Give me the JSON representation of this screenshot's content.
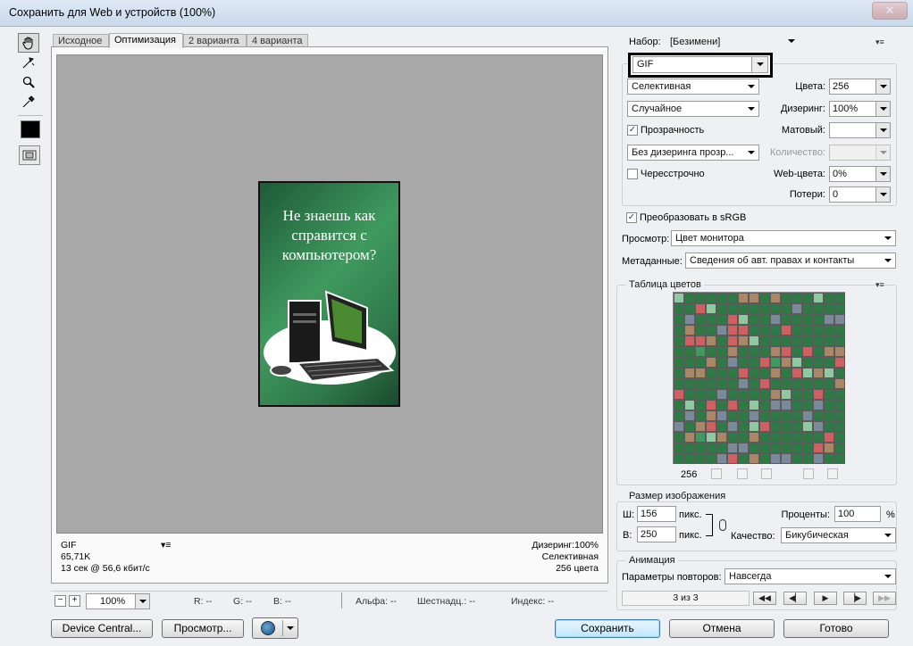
{
  "window": {
    "title": "Сохранить для Web и устройств (100%)"
  },
  "tabs": [
    {
      "label": "Исходное"
    },
    {
      "label": "Оптимизация"
    },
    {
      "label": "2 варианта"
    },
    {
      "label": "4 варианта"
    }
  ],
  "image": {
    "text_line1": "Не знаешь как",
    "text_line2": "справится с",
    "text_line3": "компьютером?"
  },
  "info": {
    "format": "GIF",
    "size": "65,71K",
    "time": "13 сек @ 56,6 кбит/с",
    "dither": "Дизеринг:100%",
    "palette": "Селективная",
    "colors": "256 цвета"
  },
  "status": {
    "zoom": "100%",
    "r": "R: --",
    "g": "G: --",
    "b": "B: --",
    "alpha": "Альфа: --",
    "hex": "Шестнадц.: --",
    "index": "Индекс: --"
  },
  "buttons": {
    "device_central": "Device Central...",
    "preview": "Просмотр...",
    "save": "Сохранить",
    "cancel": "Отмена",
    "done": "Готово"
  },
  "settings": {
    "preset_label": "Набор:",
    "preset_value": "[Безимени]",
    "format": "GIF",
    "reduction": "Селективная",
    "colors_label": "Цвета:",
    "colors_value": "256",
    "dither_algo": "Случайное",
    "dither_label": "Дизеринг:",
    "dither_value": "100%",
    "transparency_label": "Прозрачность",
    "matte_label": "Матовый:",
    "matte_value": "",
    "transp_dither": "Без дизеринга прозр...",
    "amount_label": "Количество:",
    "amount_value": "",
    "interlaced_label": "Чересстрочно",
    "web_snap_label": "Web-цвета:",
    "web_snap_value": "0%",
    "lossy_label": "Потери:",
    "lossy_value": "0",
    "srgb_label": "Преобразовать в sRGB",
    "preview_label": "Просмотр:",
    "preview_value": "Цвет монитора",
    "metadata_label": "Метаданные:",
    "metadata_value": "Сведения об авт. правах и контакты"
  },
  "color_table": {
    "title": "Таблица цветов",
    "count": "256"
  },
  "image_size": {
    "title": "Размер изображения",
    "w_label": "Ш:",
    "w_value": "156",
    "h_label": "В:",
    "h_value": "250",
    "unit": "пикс.",
    "percent_label": "Проценты:",
    "percent_value": "100",
    "percent_unit": "%",
    "quality_label": "Качество:",
    "quality_value": "Бикубическая"
  },
  "animation": {
    "title": "Анимация",
    "loop_label": "Параметры повторов:",
    "loop_value": "Навсегда",
    "frame": "3 из 3"
  },
  "colors": {
    "accent": "#3c7fb1",
    "image_green": "#3f9a5e"
  }
}
